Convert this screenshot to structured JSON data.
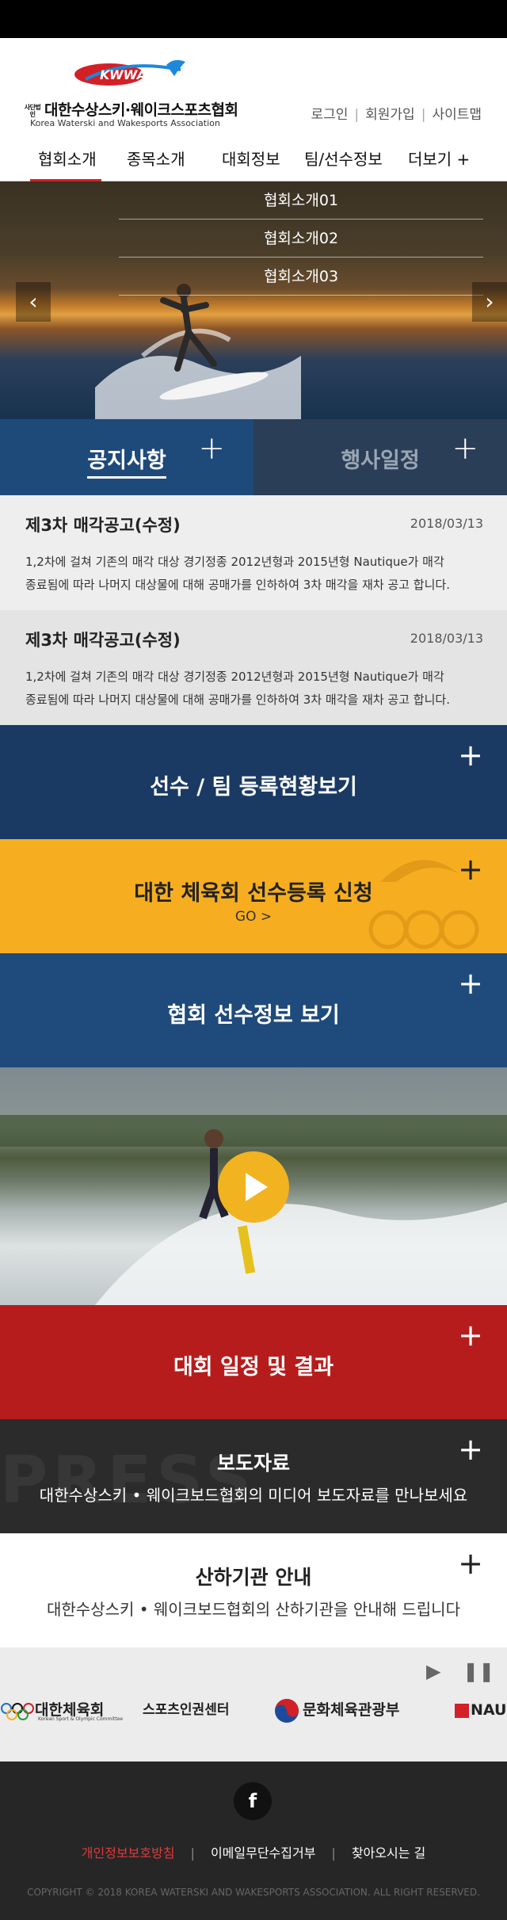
{
  "brand": {
    "logo_text": "KWWA",
    "org_prefix": "사단법인",
    "org_name_ko": "대한수상스키·웨이크스포츠협회",
    "org_name_en": "Korea Waterski and Wakesports Association"
  },
  "utility_links": [
    "로그인",
    "회원가입",
    "사이트맵"
  ],
  "nav": {
    "items": [
      "협회소개",
      "종목소개",
      "대회정보",
      "팀/선수정보",
      "더보기 +"
    ],
    "active_index": 0,
    "accent_color": "#d32027"
  },
  "hero": {
    "dropdown_items": [
      "협회소개01",
      "협회소개02",
      "협회소개03"
    ],
    "prev_label": "‹",
    "next_label": "›"
  },
  "board_tabs": {
    "tabs": [
      "공지사항",
      "행사일정"
    ],
    "active_index": 0,
    "more_label": "+"
  },
  "notices": [
    {
      "title": "제3차 매각공고(수정)",
      "date": "2018/03/13",
      "body_line1": "1,2차에 걸쳐 기존의 매각 대상 경기정종 2012년형과 2015년형 Nautique가 매각",
      "body_line2": "종료됨에 따라 나머지 대상물에 대해 공매가를 인하하여 3차 매각을 재차 공고 합니다."
    },
    {
      "title": "제3차 매각공고(수정)",
      "date": "2018/03/13",
      "body_line1": "1,2차에 걸쳐 기존의 매각 대상 경기정종 2012년형과 2015년형 Nautique가 매각",
      "body_line2": "종료됨에 따라 나머지 대상물에 대해 공매가를 인하하여 3차 매각을 재차 공고 합니다."
    }
  ],
  "banners": {
    "registration": {
      "label": "선수 / 팀 등록현황보기",
      "plus": "+"
    },
    "korea_sports": {
      "label": "대한 체육회 선수등록 신청",
      "go": "GO >",
      "plus": "+",
      "color": "#f6ae20"
    },
    "player_info": {
      "label": "협회 선수정보 보기",
      "plus": "+"
    },
    "video": {
      "play_icon": "play-icon",
      "color": "#f2b321"
    },
    "results": {
      "label": "대회 일정 및 결과",
      "plus": "+"
    },
    "press": {
      "ghost": "PRESS",
      "label": "보도자료",
      "sub": "대한수상스키 • 웨이크보드협회의 미디어 보도자료를 만나보세요",
      "plus": "+"
    },
    "affiliates": {
      "label": "산하기관 안내",
      "sub": "대한수상스키 • 웨이크보드협회의 산하기관을 안내해 드립니다",
      "plus": "+"
    }
  },
  "partners": {
    "items": [
      "대한체육회",
      "스포츠인권센터",
      "문화체육관광부",
      "NAU"
    ],
    "sub_caption": "Korean Sport & Olympic Committee",
    "play_label": "▶",
    "pause_label": "❚❚"
  },
  "footer": {
    "social": "f",
    "links": [
      "개인정보보호방침",
      "이메일무단수집거부",
      "찾아오시는 길"
    ],
    "highlight_color": "#e03a3a",
    "copyright": "COPYRIGHT © 2018 KOREA WATERSKI AND WAKESPORTS ASSOCIATION. ALL RIGHT RESERVED."
  }
}
